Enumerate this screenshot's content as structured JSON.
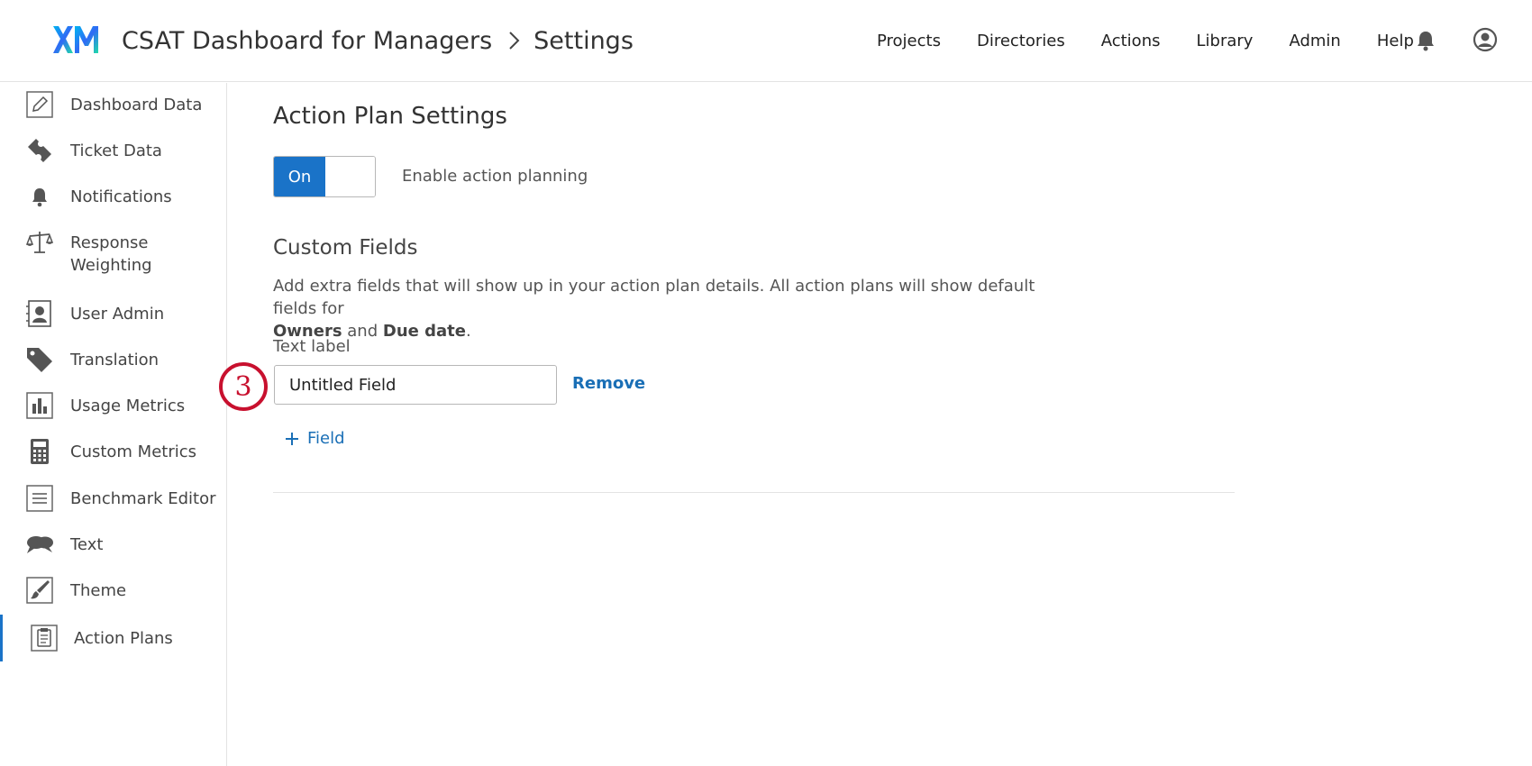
{
  "header": {
    "logo_text": "XM",
    "project_title": "CSAT Dashboard for Managers",
    "current_page": "Settings",
    "nav": [
      "Projects",
      "Directories",
      "Actions",
      "Library",
      "Admin",
      "Help"
    ]
  },
  "sidebar": {
    "items": [
      {
        "label": "Dashboard Data",
        "icon": "pencil-icon"
      },
      {
        "label": "Ticket Data",
        "icon": "ticket-icon"
      },
      {
        "label": "Notifications",
        "icon": "bell-icon"
      },
      {
        "label": "Response Weighting",
        "icon": "scale-icon"
      },
      {
        "label": "User Admin",
        "icon": "user-card-icon"
      },
      {
        "label": "Translation",
        "icon": "tag-icon"
      },
      {
        "label": "Usage Metrics",
        "icon": "bar-chart-icon"
      },
      {
        "label": "Custom Metrics",
        "icon": "calculator-icon"
      },
      {
        "label": "Benchmark Editor",
        "icon": "list-icon"
      },
      {
        "label": "Text",
        "icon": "chat-bubbles-icon"
      },
      {
        "label": "Theme",
        "icon": "paintbrush-icon"
      },
      {
        "label": "Action Plans",
        "icon": "clipboard-icon"
      }
    ],
    "active_index": 11
  },
  "main": {
    "title": "Action Plan Settings",
    "toggle_on_label": "On",
    "toggle_state": true,
    "toggle_description": "Enable action planning",
    "custom_fields_title": "Custom Fields",
    "description_prefix": "Add extra fields that will show up in your action plan details. All action plans will show default fields for",
    "description_owners": "Owners",
    "description_and": "and",
    "description_due": "Due date",
    "description_end": ".",
    "text_label": "Text label",
    "field_value": "Untitled Field",
    "remove_label": "Remove",
    "add_field_label": "Field"
  },
  "annotation": {
    "step_number": "3"
  },
  "colors": {
    "accent": "#1a73c8",
    "link": "#1a6fb6",
    "annotation": "#c8102e"
  }
}
